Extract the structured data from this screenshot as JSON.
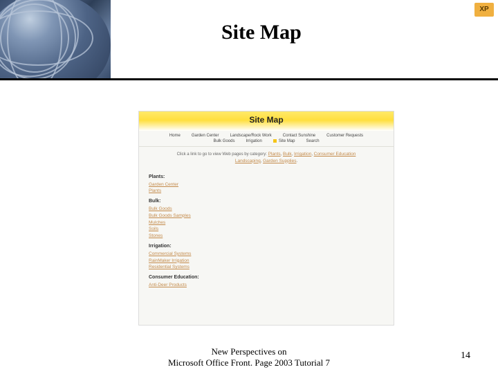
{
  "slide": {
    "title": "Site Map",
    "badge": "XP"
  },
  "screenshot": {
    "banner_title": "Site Map",
    "nav_row1": [
      "Home",
      "Garden Center",
      "Landscape/Rock Work",
      "Contact Sunshine",
      "Customer Requests"
    ],
    "nav_row2": [
      "Bulk Goods",
      "Irrigation",
      "Site Map",
      "Search"
    ],
    "intro_prefix": "Click a link to go to view Web pages by category: ",
    "intro_links": [
      "Plants",
      "Bulk",
      "Irrigation",
      "Consumer Education",
      "Landscaping",
      "Garden Supplies"
    ],
    "categories": [
      {
        "heading": "Plants:",
        "links": [
          "Garden Center",
          "Plants"
        ]
      },
      {
        "heading": "Bulk:",
        "links": [
          "Bulk Goods",
          "Bulk Goods Samples",
          "Mulches",
          "Soils",
          "Stones"
        ]
      },
      {
        "heading": "Irrigation:",
        "links": [
          "Commercial Systems",
          "RainMaker Irrigation",
          "Residential Systems"
        ]
      },
      {
        "heading": "Consumer Education:",
        "links": [
          "Anti-Deer Products"
        ]
      }
    ]
  },
  "footer": {
    "line1": "New Perspectives on",
    "line2": "Microsoft Office Front. Page 2003 Tutorial 7",
    "page": "14"
  }
}
